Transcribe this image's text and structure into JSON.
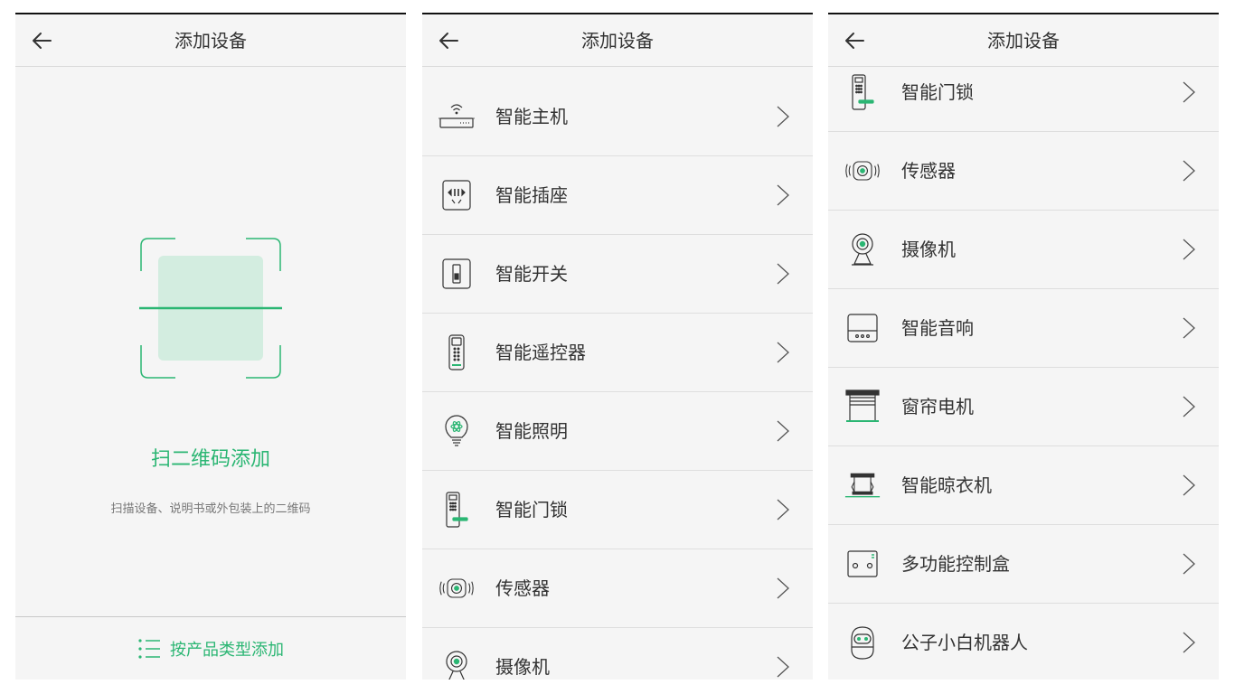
{
  "colors": {
    "accent": "#2bb673",
    "text": "#333333",
    "divider": "#dedede",
    "background": "#f5f5f5"
  },
  "screen1": {
    "header": {
      "back_icon": "arrow-left-icon",
      "title": "添加设备"
    },
    "scan_title": "扫二维码添加",
    "scan_desc": "扫描设备、说明书或外包装上的二维码",
    "footer": {
      "icon": "list-icon",
      "label": "按产品类型添加"
    }
  },
  "screen2": {
    "header": {
      "back_icon": "arrow-left-icon",
      "title": "添加设备"
    },
    "items": [
      {
        "label": "智能主机",
        "icon": "router-icon"
      },
      {
        "label": "智能插座",
        "icon": "socket-icon"
      },
      {
        "label": "智能开关",
        "icon": "switch-icon"
      },
      {
        "label": "智能遥控器",
        "icon": "remote-icon"
      },
      {
        "label": "智能照明",
        "icon": "bulb-icon"
      },
      {
        "label": "智能门锁",
        "icon": "door-lock-icon"
      },
      {
        "label": "传感器",
        "icon": "sensor-icon"
      },
      {
        "label": "摄像机",
        "icon": "camera-icon"
      }
    ]
  },
  "screen3": {
    "header": {
      "back_icon": "arrow-left-icon",
      "title": "添加设备"
    },
    "items": [
      {
        "label": "智能门锁",
        "icon": "door-lock-icon"
      },
      {
        "label": "传感器",
        "icon": "sensor-icon"
      },
      {
        "label": "摄像机",
        "icon": "camera-icon"
      },
      {
        "label": "智能音响",
        "icon": "speaker-icon"
      },
      {
        "label": "窗帘电机",
        "icon": "curtain-icon"
      },
      {
        "label": "智能晾衣机",
        "icon": "clothes-dryer-icon"
      },
      {
        "label": "多功能控制盒",
        "icon": "control-box-icon"
      },
      {
        "label": "公子小白机器人",
        "icon": "robot-icon"
      }
    ]
  }
}
